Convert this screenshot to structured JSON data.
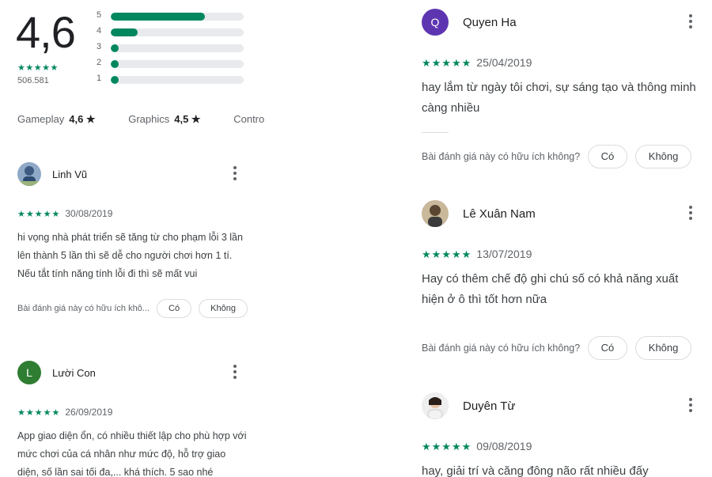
{
  "rating": {
    "score": "4,6",
    "stars": "★★★★★",
    "count": "506.581",
    "distribution": [
      {
        "label": "5",
        "fraction": 0.71
      },
      {
        "label": "4",
        "fraction": 0.2
      },
      {
        "label": "3",
        "fraction": 0.03
      },
      {
        "label": "2",
        "fraction": 0.03
      },
      {
        "label": "1",
        "fraction": 0.03
      }
    ]
  },
  "aspects": [
    {
      "label": "Gameplay",
      "value": "4,6 ★"
    },
    {
      "label": "Graphics",
      "value": "4,5 ★"
    },
    {
      "label": "Contro",
      "value": ""
    }
  ],
  "reviews_left": [
    {
      "name": "Linh Vũ",
      "avatar": "photo",
      "stars": "★★★★★",
      "date": "30/08/2019",
      "text": "hi vọng nhà phát triển sẽ tăng từ cho phạm lỗi 3 lần lên thành 5 lần thì sẽ dễ cho người chơi hơn 1 tí. Nếu tắt tính năng tính lỗi đi thì sẽ mất vui",
      "helpful": "Bài đánh giá này có hữu ích khô...",
      "yes": "Có",
      "no": "Không"
    },
    {
      "name": "Lười Con",
      "avatar_letter": "L",
      "avatar_color": "#2e7d32",
      "stars": "★★★★★",
      "date": "26/09/2019",
      "text": "App giao diện ổn, có nhiều thiết lập cho phù hợp với mức chơi của cá nhân như mức độ, hỗ trợ giao diện, số lần sai tối đa,... khá thích. 5 sao nhé"
    }
  ],
  "reviews_right": [
    {
      "name": "Quyen Ha",
      "avatar_letter": "Q",
      "avatar_color": "#5e35b1",
      "stars": "★★★★★",
      "date": "25/04/2019",
      "text": "hay lắm từ ngày tôi chơi, sự sáng tạo và thông minh càng nhiều",
      "helpful": "Bài đánh giá này có hữu ích không?",
      "yes": "Có",
      "no": "Không"
    },
    {
      "name": "Lê Xuân Nam",
      "avatar": "photo",
      "stars": "★★★★★",
      "date": "13/07/2019",
      "text": "Hay có thêm chế độ ghi chú số có khả năng xuất hiện ở ô thì tốt hơn nữa",
      "helpful": "Bài đánh giá này có hữu ích không?",
      "yes": "Có",
      "no": "Không"
    },
    {
      "name": "Duyên Từ",
      "avatar": "photo",
      "stars": "★★★★★",
      "date": "09/08/2019",
      "text": "hay, giải trí và căng đông não rất nhiều đấy"
    }
  ]
}
